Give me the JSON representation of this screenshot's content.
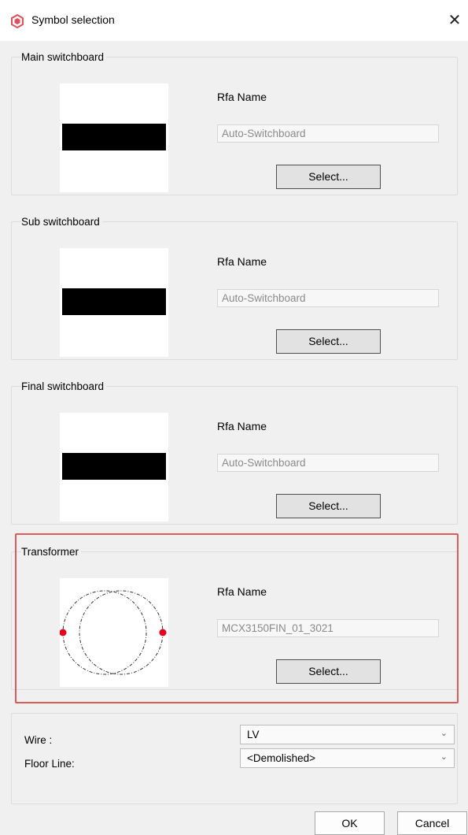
{
  "window": {
    "title": "Symbol selection",
    "close_glyph": "✕"
  },
  "groups": [
    {
      "title": "Main switchboard",
      "rfa_label": "Rfa Name",
      "rfa_value": "Auto-Switchboard",
      "select_label": "Select...",
      "preview": "switchboard-bar"
    },
    {
      "title": "Sub switchboard",
      "rfa_label": "Rfa Name",
      "rfa_value": "Auto-Switchboard",
      "select_label": "Select...",
      "preview": "switchboard-bar"
    },
    {
      "title": "Final switchboard",
      "rfa_label": "Rfa Name",
      "rfa_value": "Auto-Switchboard",
      "select_label": "Select...",
      "preview": "switchboard-bar"
    },
    {
      "title": "Transformer",
      "rfa_label": "Rfa Name",
      "rfa_value": "MCX3150FIN_01_3021",
      "select_label": "Select...",
      "preview": "transformer-symbol",
      "highlighted": true
    }
  ],
  "options": {
    "wire_label": "Wire :",
    "wire_value": "LV",
    "floor_line_label": "Floor Line:",
    "floor_line_value": "<Demolished>"
  },
  "buttons": {
    "ok": "OK",
    "cancel": "Cancel"
  },
  "colors": {
    "highlight": "#e15a5a",
    "connection_point": "#e8001c",
    "app_icon": "#e0505a"
  }
}
